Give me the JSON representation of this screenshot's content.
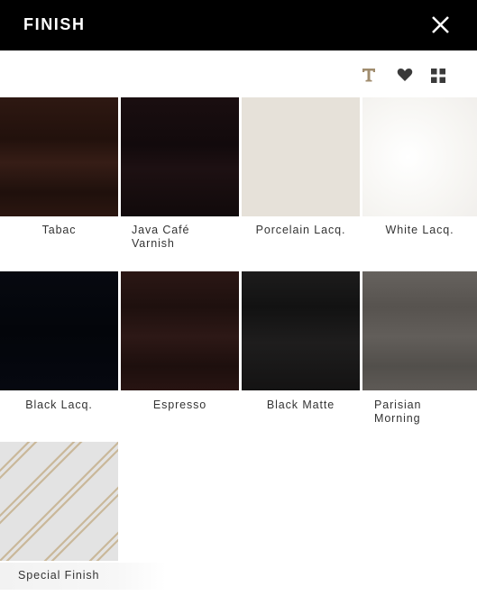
{
  "header": {
    "title": "FINISH",
    "close_icon": "close-icon"
  },
  "toolbar": {
    "icons": [
      "text-icon",
      "heart-icon",
      "grid-icon"
    ],
    "accent_color": "#a08c6e"
  },
  "finishes": [
    {
      "label": "Tabac",
      "color": "#2a1510"
    },
    {
      "label": "Java Café\nVarnish",
      "color": "#160c0e"
    },
    {
      "label": "Porcelain Lacq.",
      "color": "#e6e1d9"
    },
    {
      "label": "White Lacq.",
      "color": "#f8f7f5"
    },
    {
      "label": "Black Lacq.",
      "color": "#04060b"
    },
    {
      "label": "Espresso",
      "color": "#271513"
    },
    {
      "label": "Black Matte",
      "color": "#191818"
    },
    {
      "label": "Parisian\nMorning",
      "color": "#5d5a56"
    },
    {
      "label": "Special Finish",
      "color": "#e3e3e3"
    }
  ]
}
